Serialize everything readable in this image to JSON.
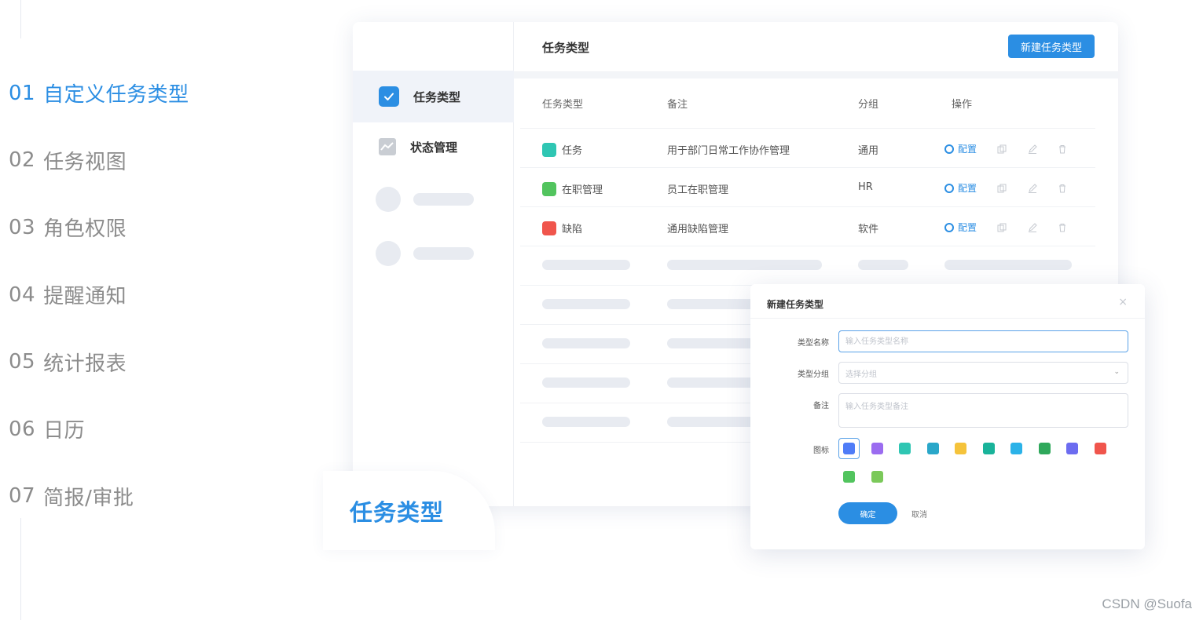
{
  "features": [
    {
      "num": "01",
      "label": "自定义任务类型",
      "active": true
    },
    {
      "num": "02",
      "label": "任务视图"
    },
    {
      "num": "03",
      "label": "角色权限"
    },
    {
      "num": "04",
      "label": "提醒通知"
    },
    {
      "num": "05",
      "label": "统计报表"
    },
    {
      "num": "06",
      "label": "日历"
    },
    {
      "num": "07",
      "label": "简报/审批"
    }
  ],
  "sidebar": {
    "items": [
      {
        "label": "任务类型",
        "icon": "check-icon",
        "active": true
      },
      {
        "label": "状态管理",
        "icon": "chart-icon"
      }
    ]
  },
  "header": {
    "title": "任务类型",
    "new_button": "新建任务类型"
  },
  "table": {
    "columns": [
      "任务类型",
      "备注",
      "分组",
      "操作"
    ],
    "rows": [
      {
        "name": "任务",
        "icon_color": "#2fc6b3",
        "note": "用于部门日常工作协作管理",
        "group": "通用",
        "action": "配置"
      },
      {
        "name": "在职管理",
        "icon_color": "#52c45e",
        "note": "员工在职管理",
        "group": "HR",
        "action": "配置"
      },
      {
        "name": "缺陷",
        "icon_color": "#f0554c",
        "note": "通用缺陷管理",
        "group": "软件",
        "action": "配置"
      }
    ]
  },
  "float_label": "任务类型",
  "dialog": {
    "title": "新建任务类型",
    "close": "×",
    "fields": {
      "name_label": "类型名称",
      "name_placeholder": "输入任务类型名称",
      "group_label": "类型分组",
      "group_placeholder": "选择分组",
      "note_label": "备注",
      "note_placeholder": "输入任务类型备注",
      "icon_label": "图标"
    },
    "icon_colors": [
      "#4f7cf7",
      "#9b6cf0",
      "#2fc6b3",
      "#2aa7c9",
      "#f5c33b",
      "#19b39a",
      "#2bb2e8",
      "#2fa85b",
      "#6c6cf0",
      "#f0554c",
      "#52c45e",
      "#7bc95a"
    ],
    "confirm": "确定",
    "cancel": "取消"
  },
  "watermark": "CSDN @Suofa",
  "colors": {
    "accent": "#2b8ee3",
    "text": "#333333",
    "muted": "#8c8c8c",
    "placeholder": "#e8ebf1"
  }
}
